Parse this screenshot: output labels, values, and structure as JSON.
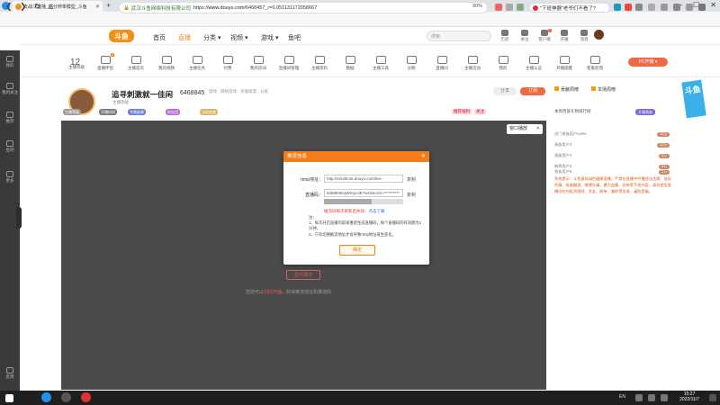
{
  "browser": {
    "tab_title": "去战斗直播_超分辨率模型_斗鱼",
    "new_tab": "+",
    "url_site": "武汉斗鱼网络科技有限公司",
    "url_scheme": "https://",
    "url_host": "www.douyu.com",
    "url_path": "/6468457_r=0.051131172058667",
    "zoom": "90%",
    "search_text": "\"下班神器\"老爷们不看了?",
    "win_min": "—",
    "win_max": "☐",
    "win_close": "✕"
  },
  "site": {
    "logo": "斗鱼",
    "nav": [
      "首页",
      "直播",
      "分类 ▾",
      "视频 ▾",
      "游戏 ▾",
      "鱼吧"
    ],
    "search_placeholder": "搜索",
    "header_icons": [
      "历史",
      "关注",
      "客户端",
      "开播",
      "消息"
    ],
    "header_badge": "2"
  },
  "categories": {
    "level_number": "12",
    "items": [
      "主播等级",
      "直播伴侣",
      "主播首页",
      "我的视频",
      "主播任务",
      "付费",
      "我的房间",
      "直播间管理",
      "主播资料",
      "数据",
      "主播工具",
      "分期",
      "直播间",
      "主播活动",
      "我的",
      "主播认证",
      "开播提醒",
      "客服反馈",
      "联系我们"
    ],
    "cat_badge": "6",
    "pc_button": "PC开播 ▾"
  },
  "room": {
    "title": "追寻刺激就一佳闲",
    "room_id": "6468845",
    "crumb": "游戏 · 网络游戏 · 英雄联盟 · 分类",
    "meta": "主播等级",
    "follow": "订阅",
    "share": "分享",
    "reports": [
      "推荐福利",
      "关注"
    ],
    "tags": [
      "主播等级",
      "开播时间",
      "专属勋章",
      "粉丝团",
      "当前热度",
      "主播贵族"
    ]
  },
  "video": {
    "float_btn": "窗口播放",
    "float_close": "✕",
    "hidden_btn": "显示推流",
    "hint_pre": "您还可以",
    "hint_link": "扫码开播",
    "hint_post": "，获得推流地址和推流码"
  },
  "modal": {
    "title": "推流信息",
    "close": "✕",
    "rtmp_label": "rtmp地址：",
    "rtmp_value": "http://sendtc3a.douyu.com/live",
    "code_label": "直播码：",
    "code_value": "6468845rqWmpc4E?wsSecret=**********",
    "copy": "复制",
    "slider_value": 0.6,
    "warn_text": "推流码每次刷新后失效，",
    "warn_link": "点击了解",
    "notes_title": "注：",
    "note1": "1、每次开启直播均前请重新生成直播码，每个直播码的有效期为1分钟。",
    "note2": "2、只有切换推流地址才会导致rtmp地址发生变化。",
    "confirm": "确定"
  },
  "right_panel": {
    "tabs": [
      "贡献周榜",
      "本场周榜"
    ],
    "rank_header": "本周贵族礼物排行榜",
    "rank_btn": "开通贵族",
    "rows": [
      {
        "name": "虎门贵族用户name",
        "val": "15万"
      },
      {
        "name": "贵族用户2",
        "val": "12万"
      },
      {
        "name": "贵族用户3",
        "val": "8万"
      },
      {
        "name": "新鲜用户4",
        "val": "5万"
      },
      {
        "name": "贵族用户5",
        "val": "2万"
      }
    ],
    "banner": "斗鱼",
    "notice": "系统提示：斗鱼倡导绿色健康直播，严禁在直播中传播违法违规、低俗色情、吸烟酗酒、赌博诈骗、暴力血腥、恐怖等不良内容，请勿相信直播间任何投资理财、交友、刷单、兼职等信息，谨防受骗。"
  },
  "sidebar": {
    "items": [
      "我的",
      "我的关注",
      "推荐",
      "鱼吧",
      "更多"
    ],
    "bottom": "反馈"
  },
  "taskbar": {
    "ime": "EN",
    "time": "15:27",
    "date": "2022/11/7"
  }
}
